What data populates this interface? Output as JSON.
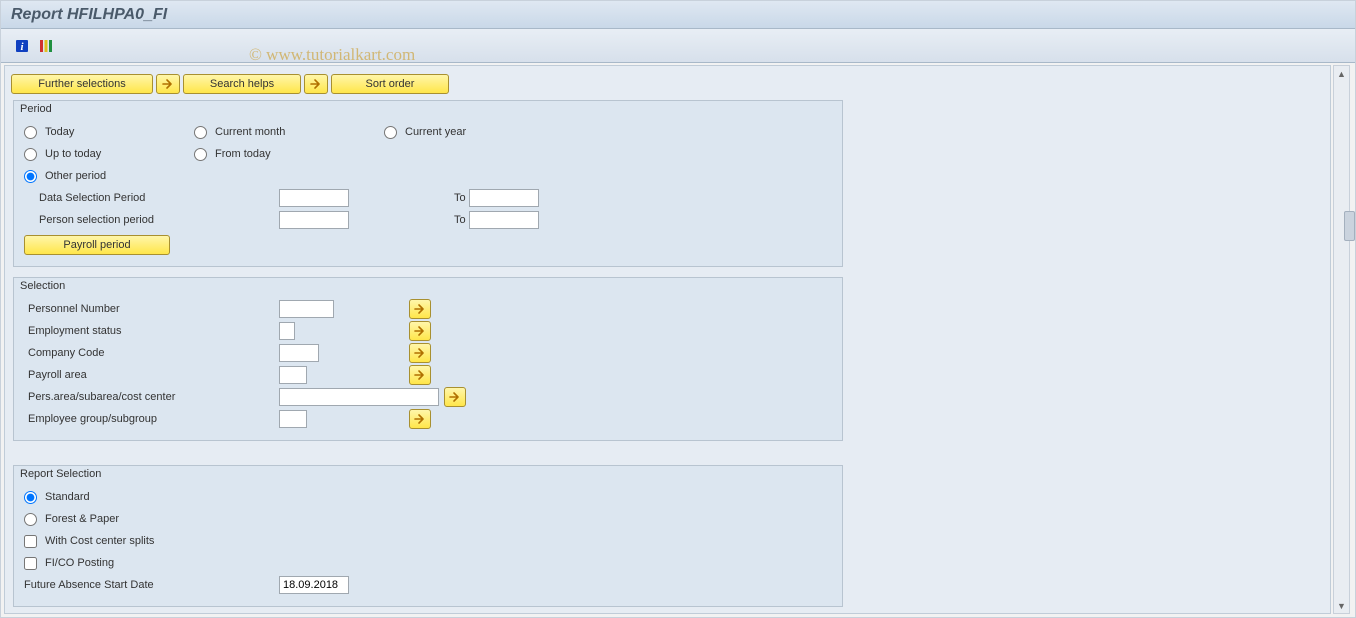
{
  "title": "Report HFILHPA0_FI",
  "watermark": "© www.tutorialkart.com",
  "action_buttons": {
    "further_selections": "Further selections",
    "search_helps": "Search helps",
    "sort_order": "Sort order"
  },
  "period": {
    "group_label": "Period",
    "today": "Today",
    "current_month": "Current month",
    "current_year": "Current year",
    "up_to_today": "Up to today",
    "from_today": "From today",
    "other_period": "Other period",
    "data_selection_period": "Data Selection Period",
    "person_selection_period": "Person selection period",
    "to": "To",
    "payroll_period_btn": "Payroll period",
    "selected": "other_period"
  },
  "selection": {
    "group_label": "Selection",
    "personnel_number": "Personnel Number",
    "employment_status": "Employment status",
    "company_code": "Company Code",
    "payroll_area": "Payroll area",
    "pers_area": "Pers.area/subarea/cost center",
    "employee_group": "Employee group/subgroup"
  },
  "report_selection": {
    "group_label": "Report Selection",
    "standard": "Standard",
    "forest_paper": "Forest & Paper",
    "with_cc_splits": "With Cost center splits",
    "fico_posting": "FI/CO Posting",
    "future_absence_label": "Future Absence Start Date",
    "future_absence_value": "18.09.2018",
    "selected": "standard"
  },
  "icons": {
    "info": "info-icon",
    "columns": "columns-icon",
    "arrow_right": "arrow-right-icon",
    "scroll_up": "▲",
    "scroll_down": "▼"
  }
}
